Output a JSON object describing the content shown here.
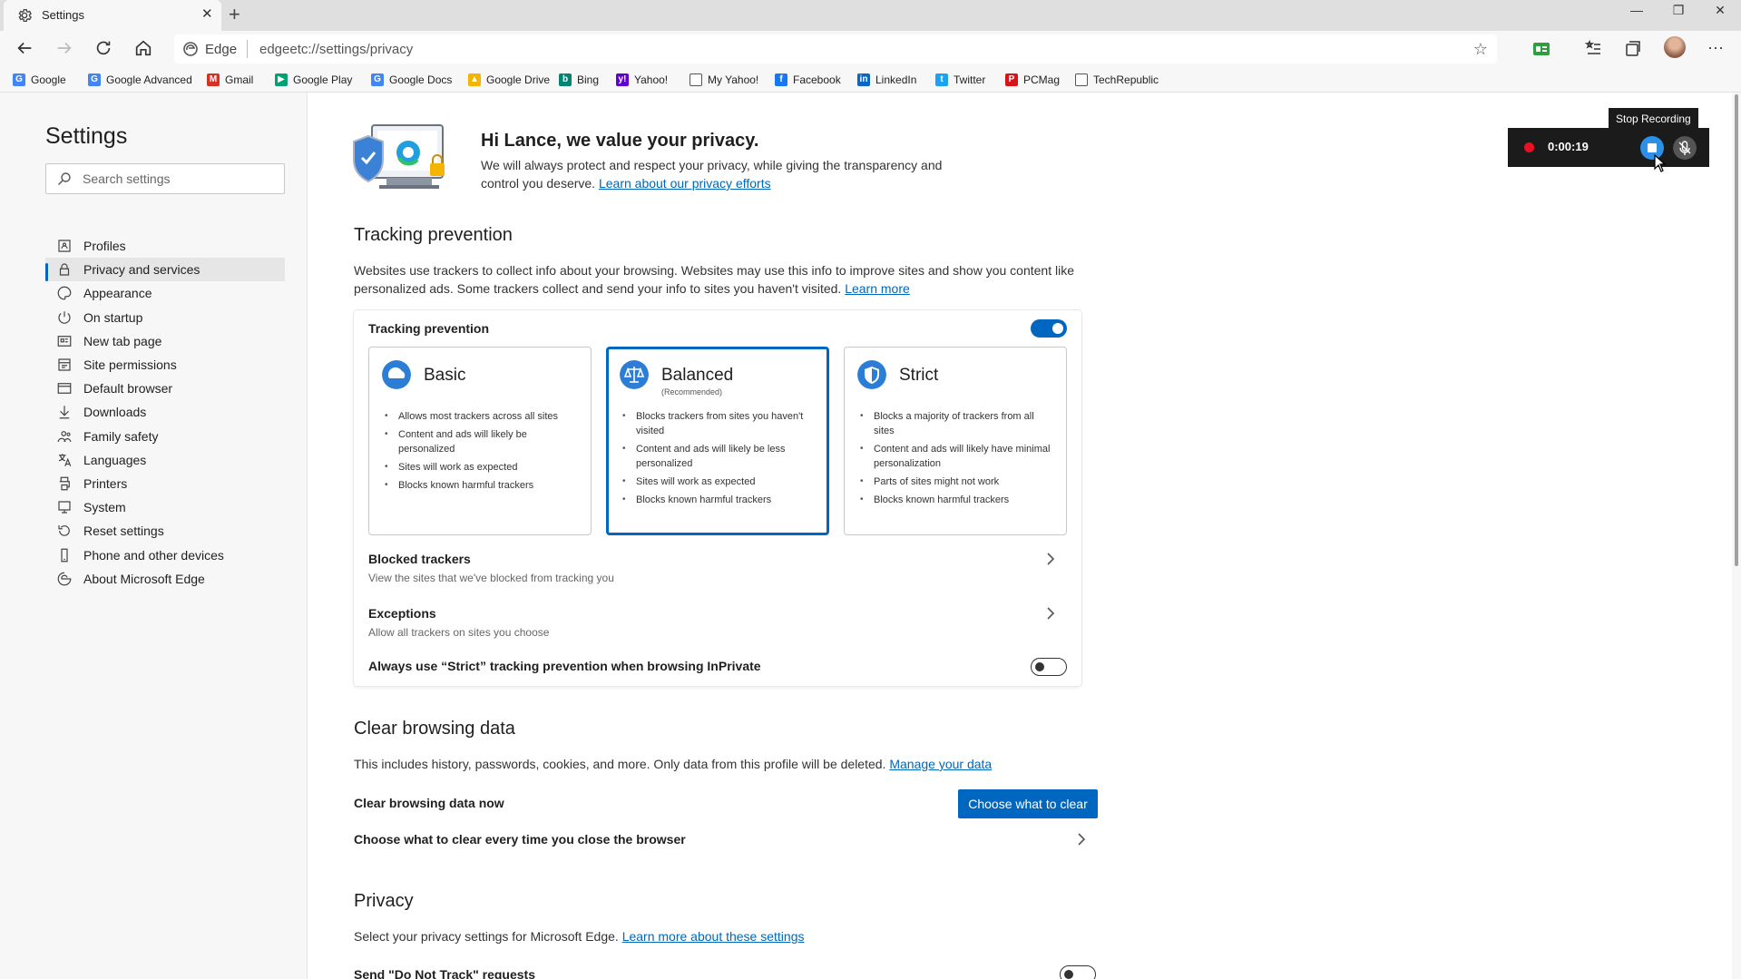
{
  "tab": {
    "title": "Settings",
    "close": "✕",
    "new": "+"
  },
  "window_controls": {
    "minimize": "—",
    "restore": "❐",
    "close": "✕"
  },
  "address": {
    "scheme_label": "Edge",
    "url": "edgeetc://settings/privacy"
  },
  "toolbar": {
    "more": "···"
  },
  "favorites": [
    {
      "label": "Google",
      "color": "#4285f4",
      "glyph": "G"
    },
    {
      "label": "Google Advanced",
      "color": "#4285f4",
      "glyph": "G"
    },
    {
      "label": "Gmail",
      "color": "#d93025",
      "glyph": "M"
    },
    {
      "label": "Google Play",
      "color": "#00a173",
      "glyph": "▶"
    },
    {
      "label": "Google Docs",
      "color": "#4285f4",
      "glyph": "G"
    },
    {
      "label": "Google Drive",
      "color": "#f4b400",
      "glyph": "▲"
    },
    {
      "label": "Bing",
      "color": "#008373",
      "glyph": "b"
    },
    {
      "label": "Yahoo!",
      "color": "#5f01d1",
      "glyph": "y!"
    },
    {
      "label": "My Yahoo!",
      "color": "#ffffff",
      "glyph": ""
    },
    {
      "label": "Facebook",
      "color": "#1877f2",
      "glyph": "f"
    },
    {
      "label": "LinkedIn",
      "color": "#0a66c2",
      "glyph": "in"
    },
    {
      "label": "Twitter",
      "color": "#1da1f2",
      "glyph": "t"
    },
    {
      "label": "PCMag",
      "color": "#d7141a",
      "glyph": "P"
    },
    {
      "label": "TechRepublic",
      "color": "#ffffff",
      "glyph": ""
    }
  ],
  "sidebar": {
    "title": "Settings",
    "search_placeholder": "Search settings",
    "items": [
      {
        "label": "Profiles",
        "icon": "profile-icon"
      },
      {
        "label": "Privacy and services",
        "icon": "lock-icon"
      },
      {
        "label": "Appearance",
        "icon": "palette-icon"
      },
      {
        "label": "On startup",
        "icon": "power-icon"
      },
      {
        "label": "New tab page",
        "icon": "newtab-icon"
      },
      {
        "label": "Site permissions",
        "icon": "permissions-icon"
      },
      {
        "label": "Default browser",
        "icon": "browser-icon"
      },
      {
        "label": "Downloads",
        "icon": "download-icon"
      },
      {
        "label": "Family safety",
        "icon": "family-icon"
      },
      {
        "label": "Languages",
        "icon": "language-icon"
      },
      {
        "label": "Printers",
        "icon": "printer-icon"
      },
      {
        "label": "System",
        "icon": "system-icon"
      },
      {
        "label": "Reset settings",
        "icon": "reset-icon"
      },
      {
        "label": "Phone and other devices",
        "icon": "phone-icon"
      },
      {
        "label": "About Microsoft Edge",
        "icon": "edge-icon"
      }
    ],
    "active_index": 1
  },
  "hero": {
    "title": "Hi Lance, we value your privacy.",
    "body": "We will always protect and respect your privacy, while giving the transparency and control you deserve.",
    "link": "Learn about our privacy efforts"
  },
  "tracking": {
    "heading": "Tracking prevention",
    "description": "Websites use trackers to collect info about your browsing. Websites may use this info to improve sites and show you content like personalized ads. Some trackers collect and send your info to sites you haven't visited.",
    "learn_more": "Learn more",
    "card_title": "Tracking prevention",
    "enabled": true,
    "options": [
      {
        "name": "Basic",
        "sub": "",
        "bullets": [
          "Allows most trackers across all sites",
          "Content and ads will likely be personalized",
          "Sites will work as expected",
          "Blocks known harmful trackers"
        ]
      },
      {
        "name": "Balanced",
        "sub": "(Recommended)",
        "bullets": [
          "Blocks trackers from sites you haven't visited",
          "Content and ads will likely be less personalized",
          "Sites will work as expected",
          "Blocks known harmful trackers"
        ]
      },
      {
        "name": "Strict",
        "sub": "",
        "bullets": [
          "Blocks a majority of trackers from all sites",
          "Content and ads will likely have minimal personalization",
          "Parts of sites might not work",
          "Blocks known harmful trackers"
        ]
      }
    ],
    "selected": "Balanced",
    "blocked_title": "Blocked trackers",
    "blocked_sub": "View the sites that we've blocked from tracking you",
    "exceptions_title": "Exceptions",
    "exceptions_sub": "Allow all trackers on sites you choose",
    "inprivate_label": "Always use “Strict” tracking prevention when browsing InPrivate",
    "inprivate_enabled": false
  },
  "clear": {
    "heading": "Clear browsing data",
    "description": "This includes history, passwords, cookies, and more. Only data from this profile will be deleted.",
    "manage_link": "Manage your data",
    "now_label": "Clear browsing data now",
    "button": "Choose what to clear",
    "every_time_label": "Choose what to clear every time you close the browser"
  },
  "privacy": {
    "heading": "Privacy",
    "description": "Select your privacy settings for Microsoft Edge.",
    "link": "Learn more about these settings",
    "dnt_label": "Send \"Do Not Track\" requests"
  },
  "recorder": {
    "time": "0:00:19",
    "tooltip": "Stop Recording"
  },
  "colors": {
    "accent": "#0067c0",
    "link": "#0067b8",
    "record": "#e81123"
  }
}
